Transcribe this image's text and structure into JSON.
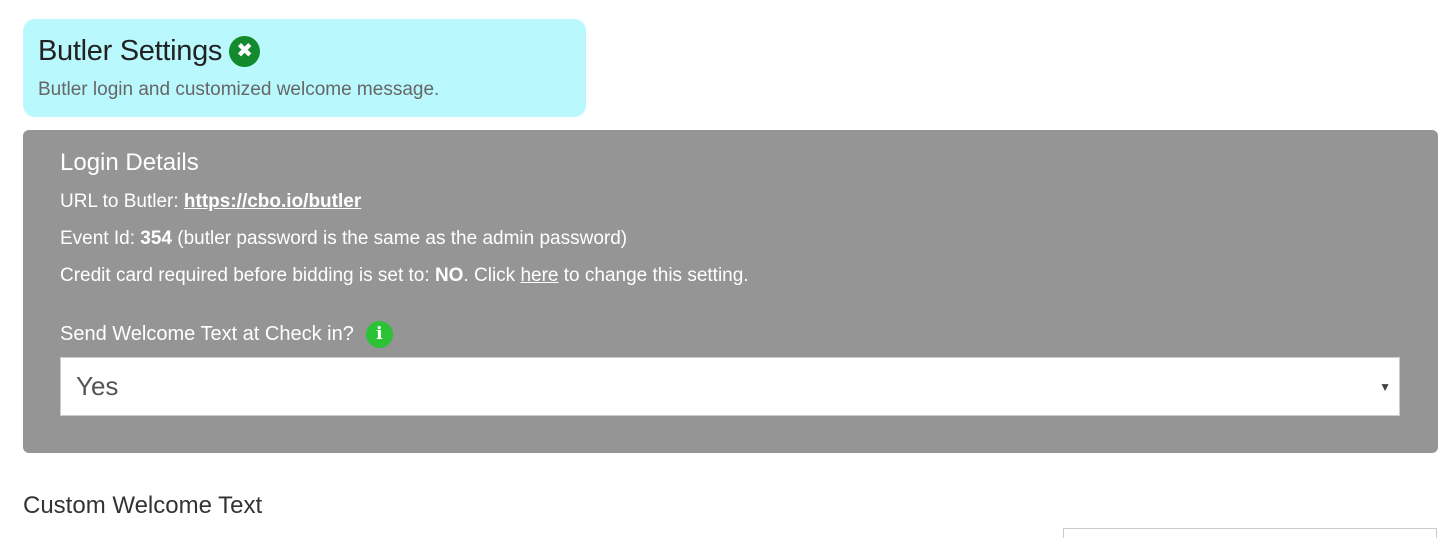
{
  "header": {
    "title": "Butler Settings",
    "subtitle": "Butler login and customized welcome message.",
    "close_icon": "close-circle-icon"
  },
  "login_details": {
    "title": "Login Details",
    "url_label": "URL to Butler: ",
    "url_value": "https://cbo.io/butler",
    "event_label": "Event Id: ",
    "event_id": "354",
    "event_note": " (butler password is the same as the admin password)",
    "credit_prefix": "Credit card required before bidding is set to: ",
    "credit_value": "NO",
    "credit_mid": ". Click ",
    "credit_link": "here",
    "credit_suffix": " to change this setting."
  },
  "welcome_text": {
    "label": "Send Welcome Text at Check in?",
    "info_icon": "info-icon",
    "selected": "Yes"
  },
  "custom_welcome": {
    "heading": "Custom Welcome Text"
  },
  "colors": {
    "header_bg": "#b9f8fd",
    "panel_bg": "#959595",
    "close_icon": "#138a2e",
    "info_icon": "#2bc236"
  }
}
